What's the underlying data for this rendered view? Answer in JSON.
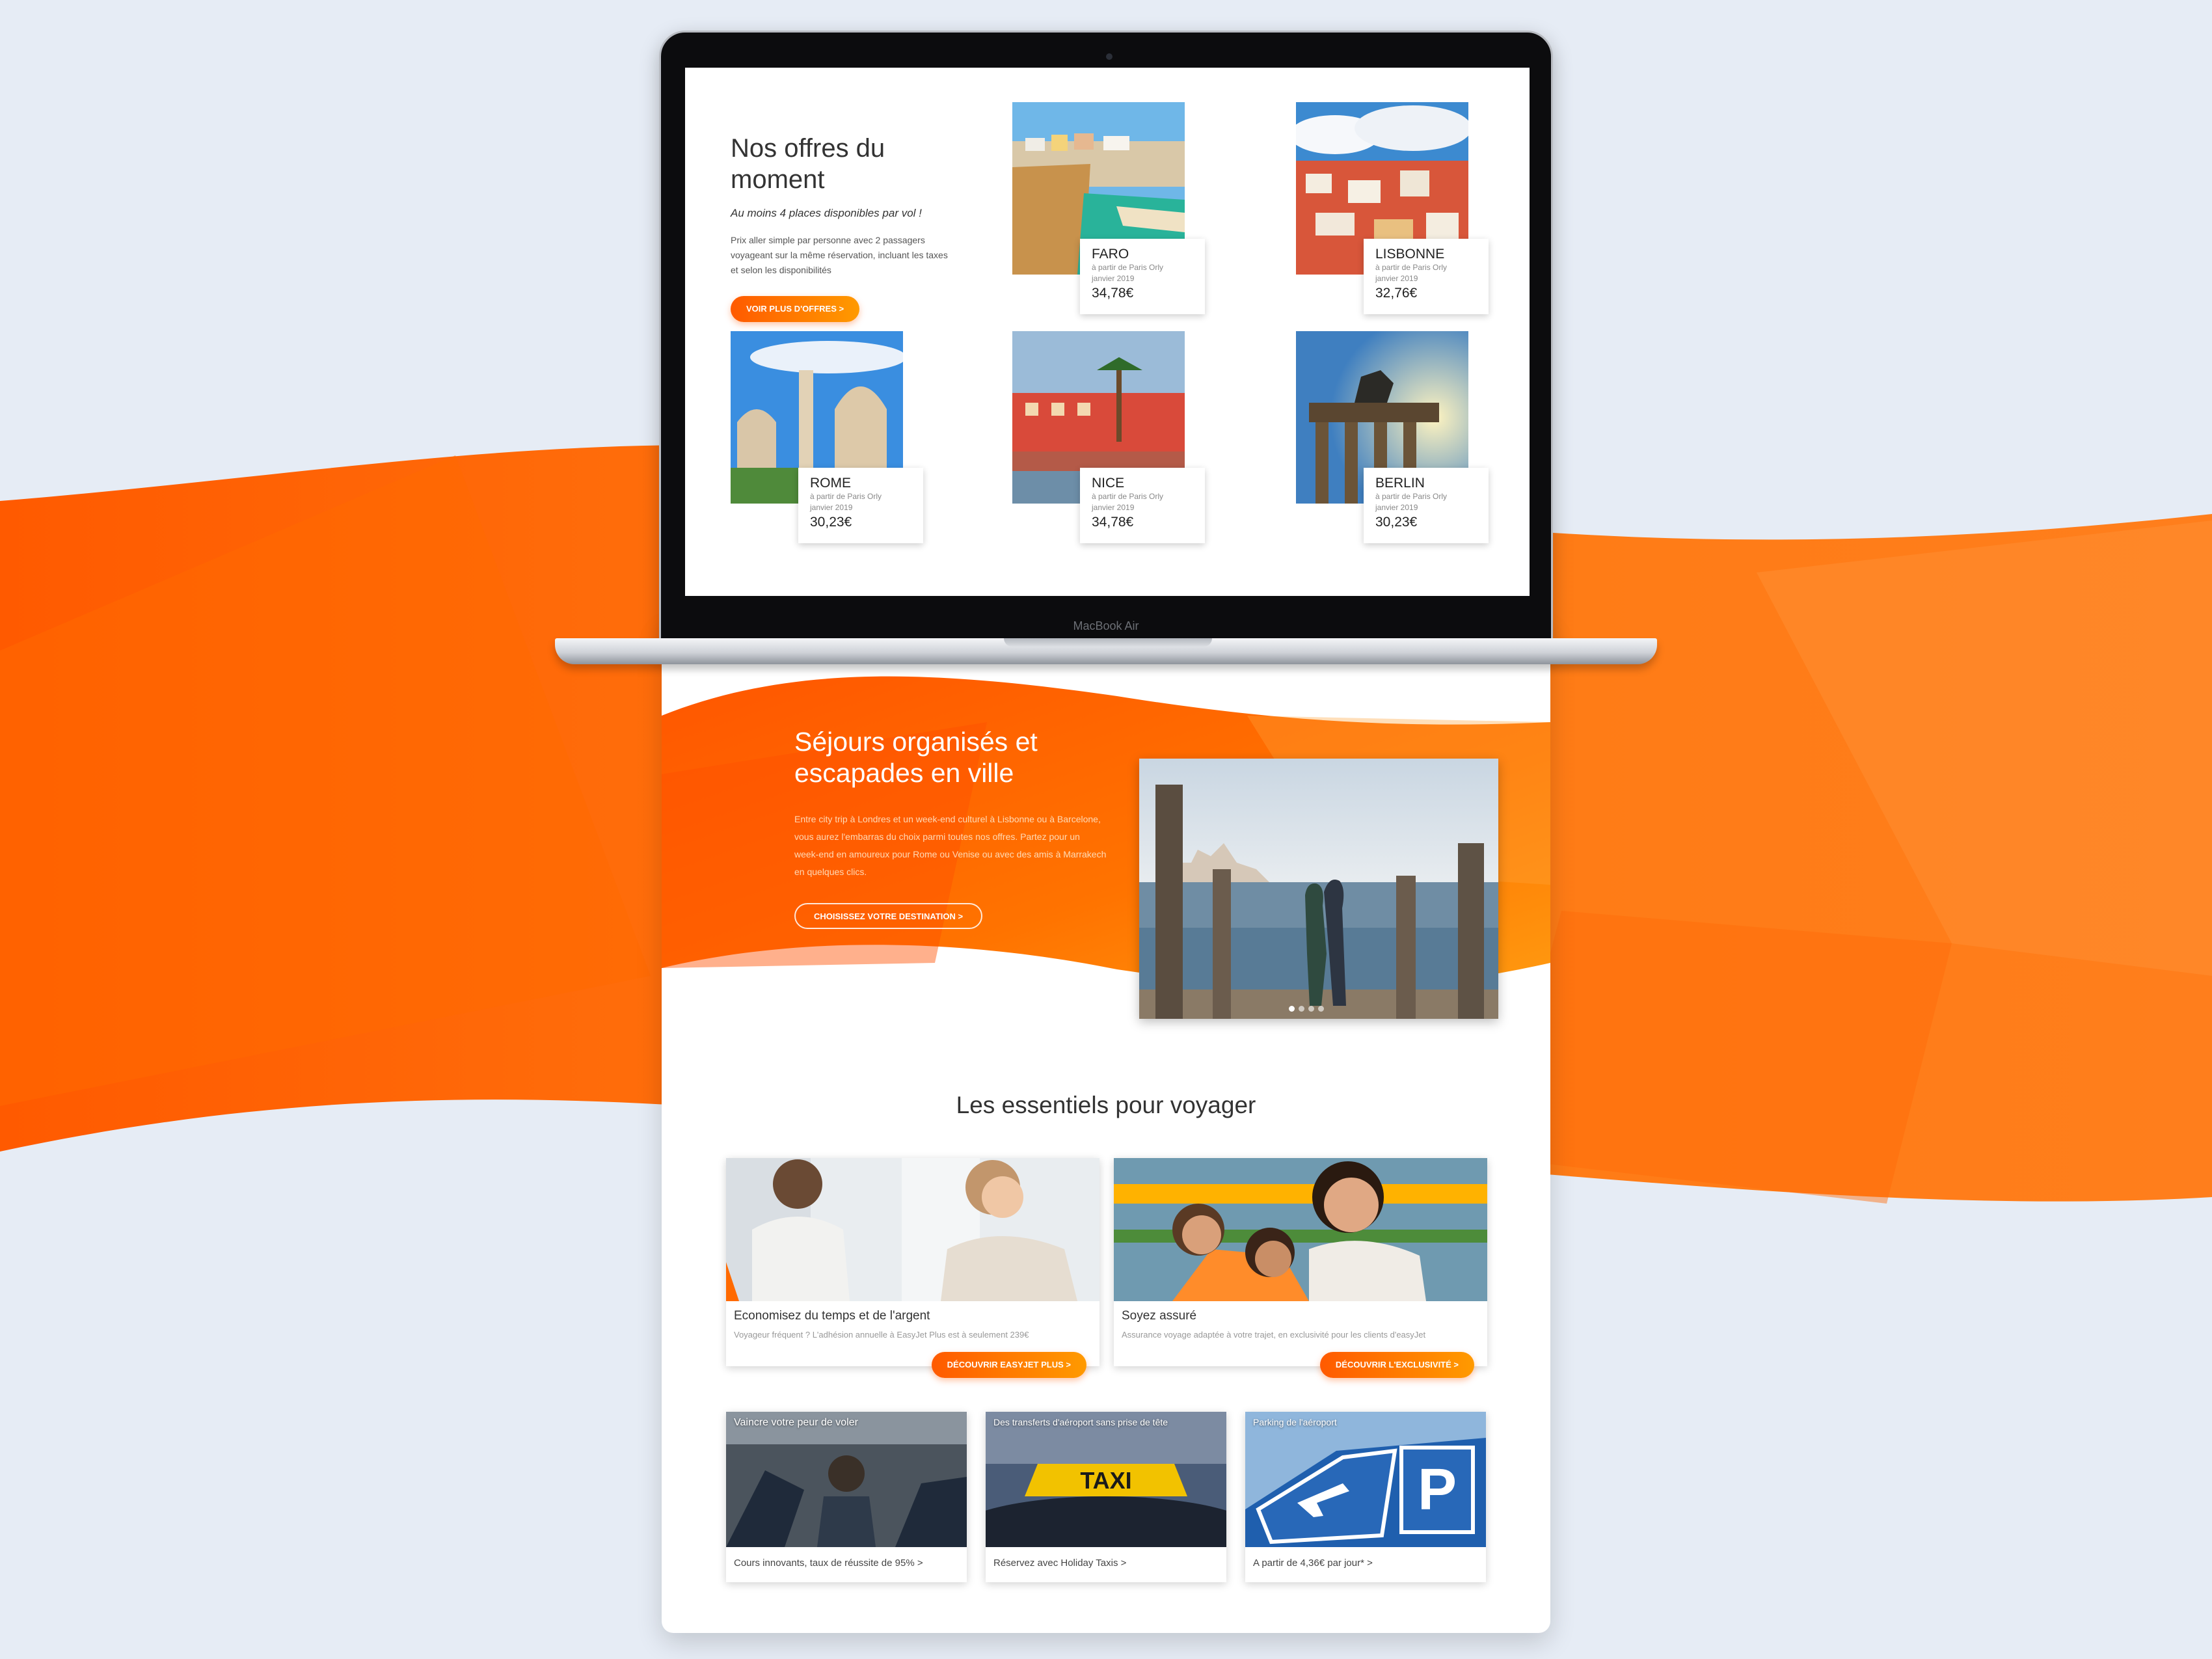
{
  "colors": {
    "accent": "#ff6a00",
    "accent_light": "#ff9a00",
    "background": "#e6ecf5"
  },
  "laptop": {
    "brand": "MacBook Air"
  },
  "offers": {
    "title": "Nos offres du moment",
    "subtitle": "Au moins 4 places disponibles par vol !",
    "description": "Prix aller simple par personne avec 2 passagers voyageant sur la même réservation, incluant les taxes et selon les disponibilités",
    "cta": "VOIR PLUS D'OFFRES >",
    "destinations": [
      {
        "name": "FARO",
        "from": "à partir de Paris Orly",
        "month": "janvier 2019",
        "price": "34,78€"
      },
      {
        "name": "LISBONNE",
        "from": "à partir de Paris Orly",
        "month": "janvier 2019",
        "price": "32,76€"
      },
      {
        "name": "ROME",
        "from": "à partir de Paris Orly",
        "month": "janvier 2019",
        "price": "30,23€"
      },
      {
        "name": "NICE",
        "from": "à partir de Paris Orly",
        "month": "janvier 2019",
        "price": "34,78€"
      },
      {
        "name": "BERLIN",
        "from": "à partir de Paris Orly",
        "month": "janvier 2019",
        "price": "30,23€"
      }
    ]
  },
  "stays": {
    "title": "Séjours organisés et escapades en ville",
    "text": "Entre city trip à Londres et un week-end culturel à Lisbonne ou à Barcelone, vous aurez l'embarras du choix parmi toutes nos offres. Partez pour un week-end en amoureux pour Rome ou Venise ou avec des amis à Marrakech en quelques clics.",
    "cta": "CHOISISSEZ VOTRE DESTINATION >"
  },
  "essentials": {
    "title": "Les essentiels pour voyager",
    "big": [
      {
        "title": "Economisez du temps et de l'argent",
        "text": "Voyageur fréquent ? L'adhésion annuelle à EasyJet Plus est à seulement 239€",
        "cta": "DÉCOUVRIR EASYJET PLUS >"
      },
      {
        "title": "Soyez assuré",
        "text": "Assurance voyage adaptée à votre trajet, en exclusivité pour les clients d'easyJet",
        "cta": "DÉCOUVRIR L'EXCLUSIVITÉ >"
      }
    ],
    "small": [
      {
        "title": "Vaincre votre peur de voler",
        "link": "Cours innovants, taux de réussite de 95% >"
      },
      {
        "title": "Des transferts d'aéroport sans prise de tête",
        "link": "Réservez avec Holiday Taxis >",
        "sign": "TAXI"
      },
      {
        "title": "Parking de l'aéroport",
        "link": "A partir de 4,36€ par jour* >",
        "sign": "P"
      }
    ]
  }
}
